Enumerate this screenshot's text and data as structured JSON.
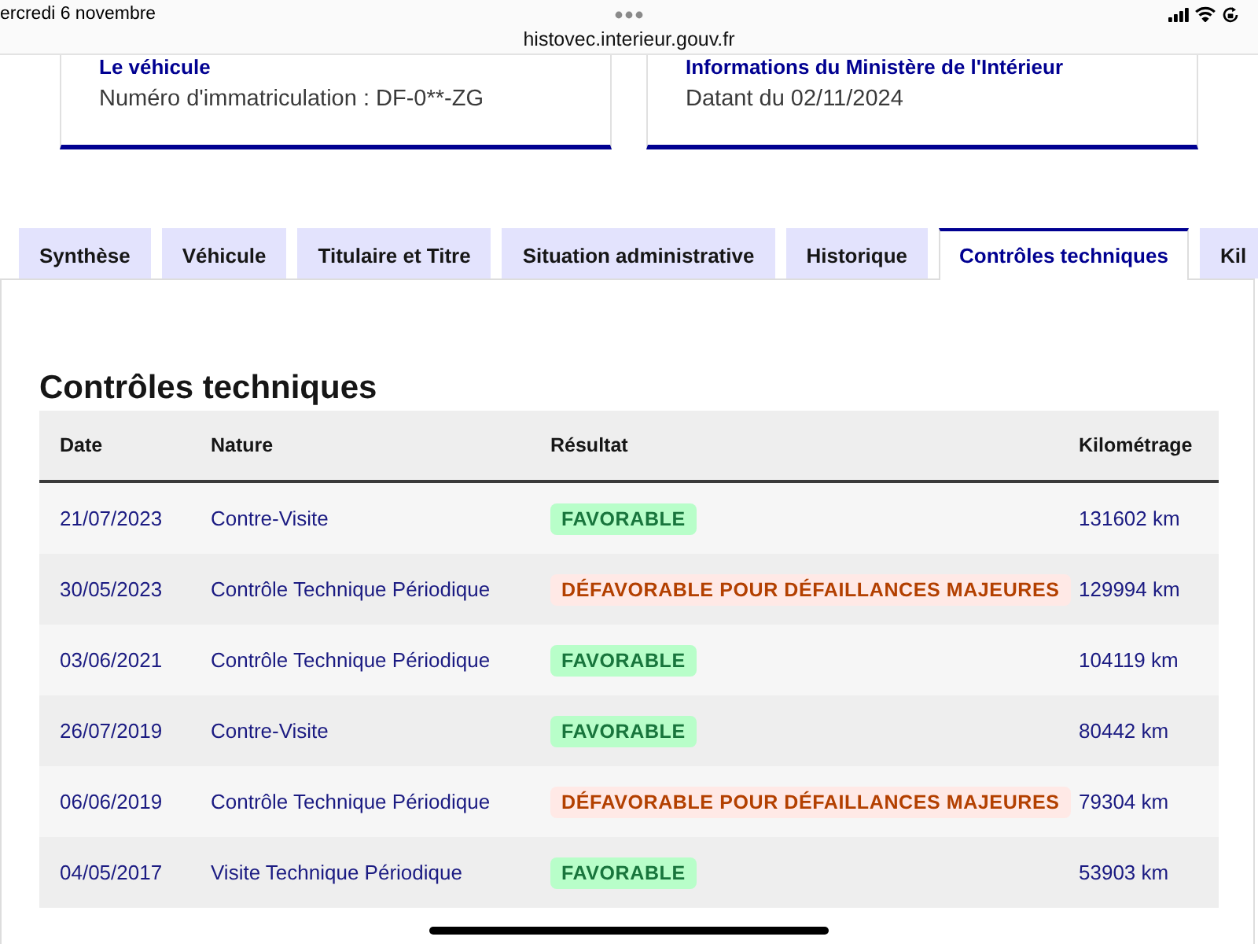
{
  "status_bar": {
    "date": "ercredi 6 novembre",
    "url": "histovec.interieur.gouv.fr"
  },
  "cards": [
    {
      "title": "Le véhicule",
      "text": "Numéro d'immatriculation : DF-0**-ZG"
    },
    {
      "title": "Informations du Ministère de l'Intérieur",
      "text": "Datant du 02/11/2024"
    }
  ],
  "tabs": [
    {
      "label": "Synthèse",
      "selected": false
    },
    {
      "label": "Véhicule",
      "selected": false
    },
    {
      "label": "Titulaire et Titre",
      "selected": false
    },
    {
      "label": "Situation administrative",
      "selected": false
    },
    {
      "label": "Historique",
      "selected": false
    },
    {
      "label": "Contrôles techniques",
      "selected": true
    },
    {
      "label": "Kil",
      "selected": false
    }
  ],
  "section": {
    "title": "Contrôles techniques",
    "table": {
      "columns": [
        "Date",
        "Nature",
        "Résultat",
        "Kilométrage"
      ],
      "rows": [
        {
          "date": "21/07/2023",
          "nature": "Contre-Visite",
          "result": {
            "text": "FAVORABLE",
            "kind": "success"
          },
          "mileage": "131602 km"
        },
        {
          "date": "30/05/2023",
          "nature": "Contrôle Technique Périodique",
          "result": {
            "text": "DÉFAVORABLE POUR DÉFAILLANCES MAJEURES",
            "kind": "warning"
          },
          "mileage": "129994 km"
        },
        {
          "date": "03/06/2021",
          "nature": "Contrôle Technique Périodique",
          "result": {
            "text": "FAVORABLE",
            "kind": "success"
          },
          "mileage": "104119 km"
        },
        {
          "date": "26/07/2019",
          "nature": "Contre-Visite",
          "result": {
            "text": "FAVORABLE",
            "kind": "success"
          },
          "mileage": "80442 km"
        },
        {
          "date": "06/06/2019",
          "nature": "Contrôle Technique Périodique",
          "result": {
            "text": "DÉFAVORABLE POUR DÉFAILLANCES MAJEURES",
            "kind": "warning"
          },
          "mileage": "79304 km"
        },
        {
          "date": "04/05/2017",
          "nature": "Visite Technique Périodique",
          "result": {
            "text": "FAVORABLE",
            "kind": "success"
          },
          "mileage": "53903 km"
        }
      ]
    }
  }
}
